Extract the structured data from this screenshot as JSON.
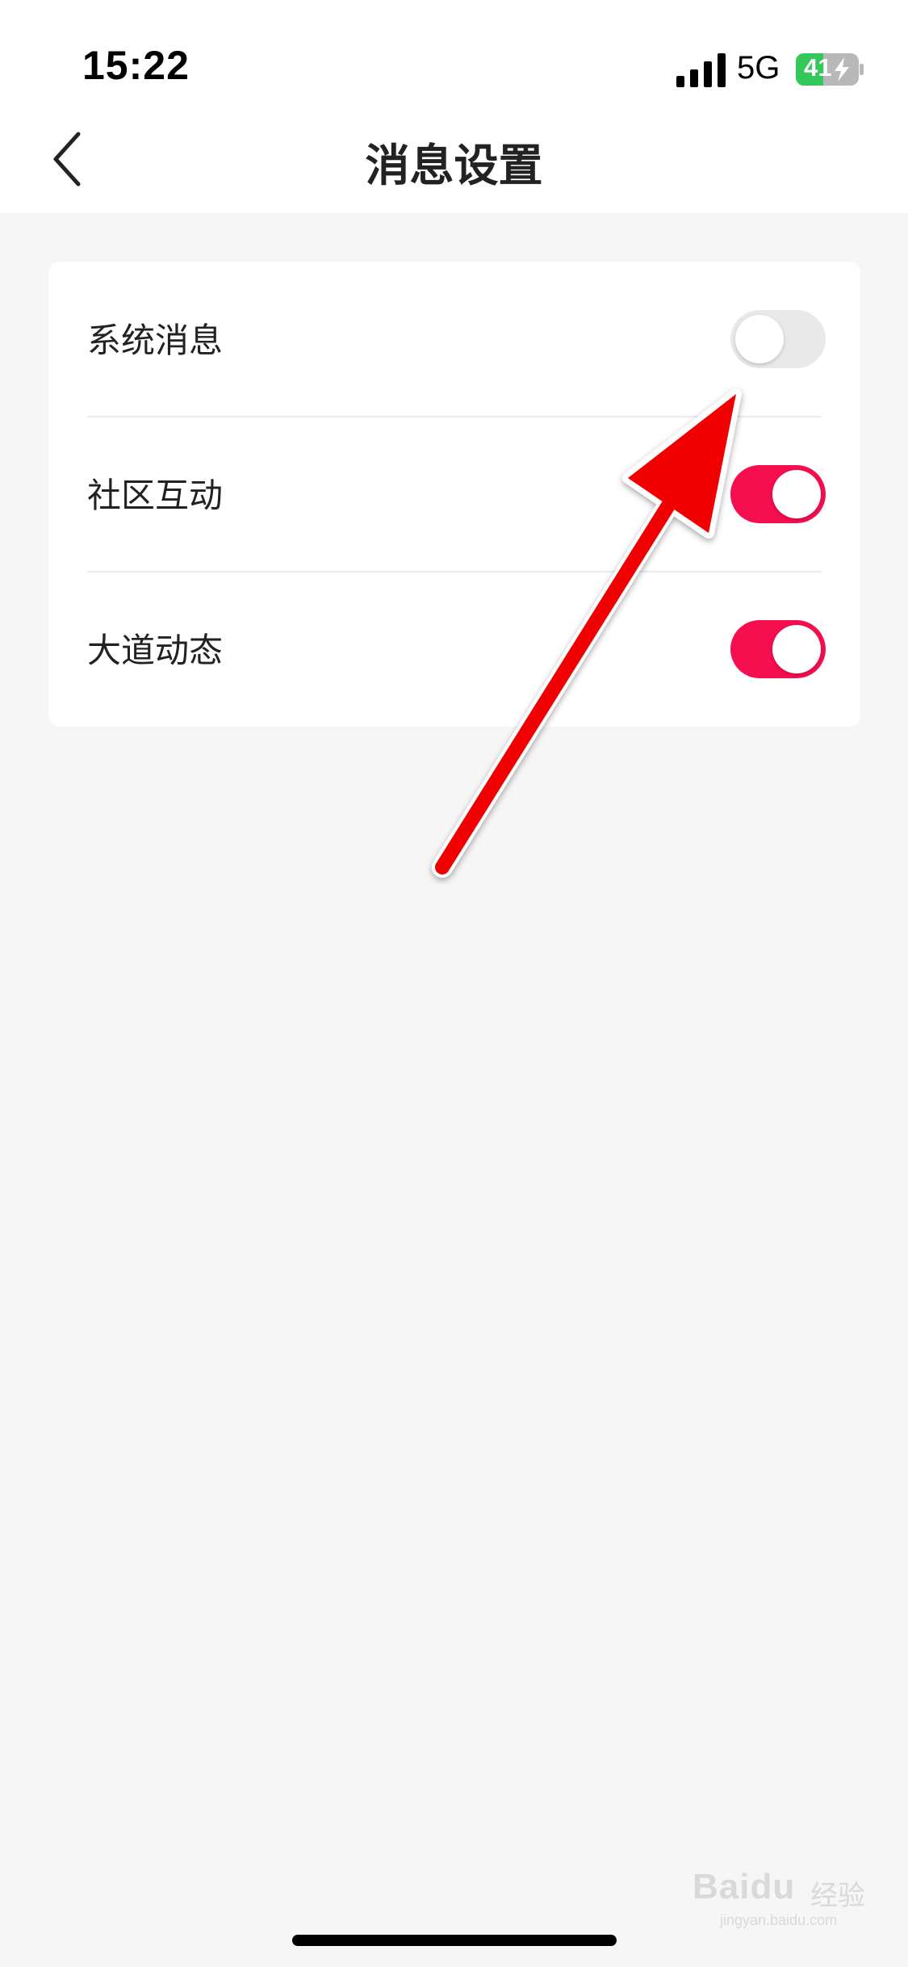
{
  "status_bar": {
    "time": "15:22",
    "network": "5G",
    "battery": "41",
    "signal_icon": "signal-bars-icon",
    "battery_icon": "battery-charging-icon",
    "battery_color": "#34c759"
  },
  "nav": {
    "title": "消息设置",
    "back_icon": "chevron-left-icon"
  },
  "settings": {
    "items": [
      {
        "label": "系统消息",
        "enabled": false
      },
      {
        "label": "社区互动",
        "enabled": true
      },
      {
        "label": "大道动态",
        "enabled": true
      }
    ]
  },
  "colors": {
    "toggle_on": "#f50f4f",
    "toggle_off": "#e9e9ea",
    "arrow": "#f00000"
  },
  "annotation": {
    "arrow_icon": "red-arrow-icon"
  },
  "watermark": {
    "brand": "Baidu",
    "sub": "经验",
    "url": "jingyan.baidu.com"
  }
}
